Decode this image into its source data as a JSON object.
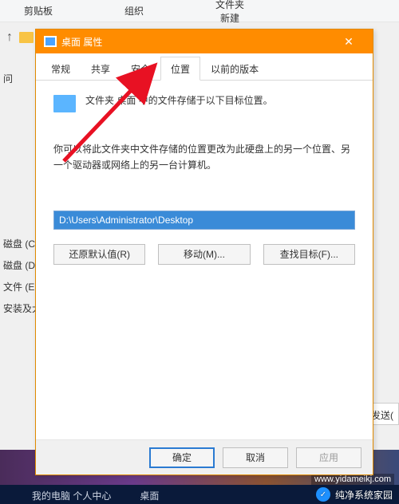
{
  "background": {
    "ribbon_groups": [
      "剪贴板",
      "组织",
      "新建"
    ],
    "ribbon_file_label": "文件夹",
    "sidebar_question": "问",
    "drives": [
      "磁盘 (C:)",
      "磁盘 (D:)",
      "文件 (E:)",
      "安装及大"
    ],
    "sendto_fragment": "发送(",
    "taskbar_items": [
      "我的电脑  个人中心",
      "桌面"
    ],
    "watermark_name": "纯净系统家园",
    "watermark_url": "www.yidameikj.com"
  },
  "dialog": {
    "title": "桌面 属性",
    "tabs": [
      {
        "label": "常规",
        "active": false
      },
      {
        "label": "共享",
        "active": false
      },
      {
        "label": "安全",
        "active": false
      },
      {
        "label": "位置",
        "active": true
      },
      {
        "label": "以前的版本",
        "active": false
      }
    ],
    "line1": "文件夹 桌面 中的文件存储于以下目标位置。",
    "line2": "你可以将此文件夹中文件存储的位置更改为此硬盘上的另一个位置、另一个驱动器或网络上的另一台计算机。",
    "path_value": "D:\\Users\\Administrator\\Desktop",
    "buttons": {
      "restore": "还原默认值(R)",
      "move": "移动(M)...",
      "find": "查找目标(F)..."
    },
    "footer": {
      "ok": "确定",
      "cancel": "取消",
      "apply": "应用"
    }
  }
}
